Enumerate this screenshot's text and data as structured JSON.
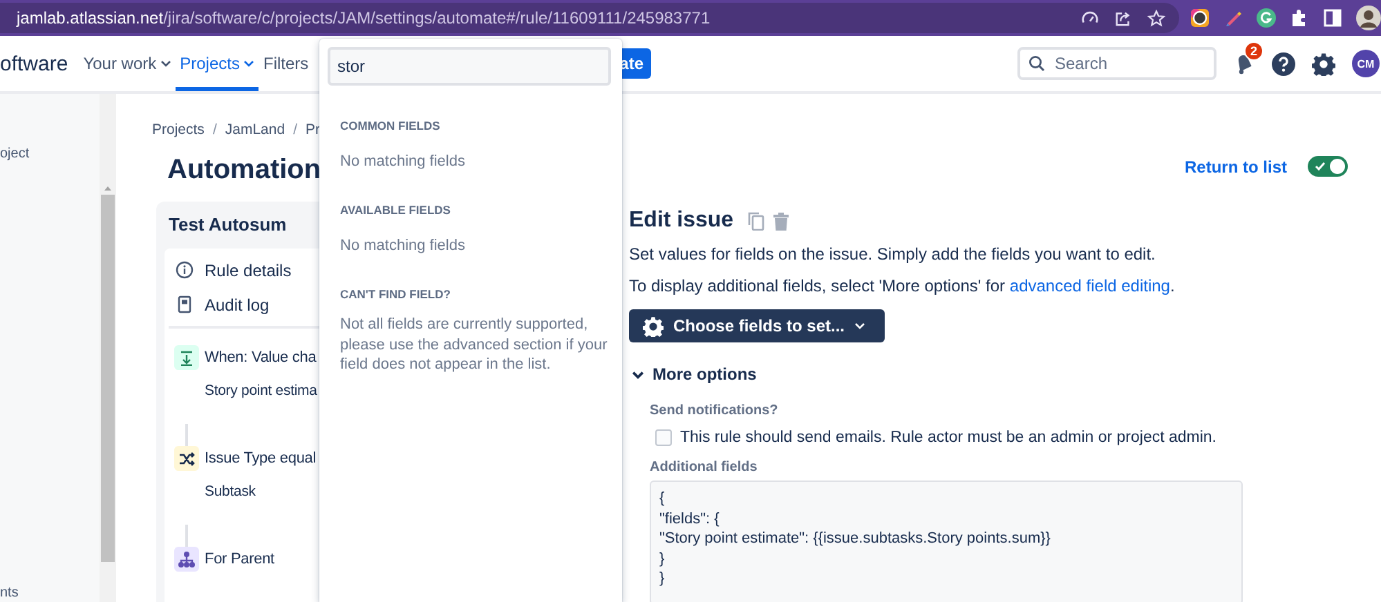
{
  "browser": {
    "url_host": "jamlab.atlassian.net",
    "url_path": "/jira/software/c/projects/JAM/settings/automate#/rule/11609111/245983771"
  },
  "top_nav": {
    "logo_text": "oftware",
    "items": [
      {
        "label": "Your work",
        "selected": false,
        "caret": true
      },
      {
        "label": "Projects",
        "selected": true,
        "caret": true
      },
      {
        "label": "Filters",
        "selected": false,
        "caret": false
      }
    ],
    "create_button": "ate",
    "search": {
      "placeholder": "Search"
    },
    "notification_count": "2",
    "avatar": "CM"
  },
  "sidebar": {
    "items": [
      "oject",
      "nts"
    ]
  },
  "breadcrumbs": [
    {
      "kind": "link",
      "text": "Projects"
    },
    {
      "kind": "separator",
      "text": "/"
    },
    {
      "kind": "link",
      "text": "JamLand"
    },
    {
      "kind": "separator",
      "text": "/"
    },
    {
      "kind": "link",
      "text": "Pr"
    }
  ],
  "page_title": "Automation",
  "return_link": "Return to list",
  "rule_enabled": true,
  "rule": {
    "title": "Test Autosum",
    "menu": [
      {
        "kind": "info",
        "label": "Rule details"
      },
      {
        "kind": "log",
        "label": "Audit log"
      }
    ],
    "steps": [
      {
        "kind": "trigger",
        "title": "When: Value cha",
        "detail": "Story point estima"
      },
      {
        "kind": "condition",
        "title": "Issue Type equal",
        "detail": "Subtask"
      },
      {
        "kind": "branch",
        "title": "For Parent"
      }
    ]
  },
  "field_picker": {
    "query": "stor",
    "sections": [
      {
        "heading": "COMMON FIELDS",
        "text": "No matching fields"
      },
      {
        "heading": "AVAILABLE FIELDS",
        "text": "No matching fields"
      },
      {
        "heading": "CAN'T FIND FIELD?",
        "text": "Not all fields are currently supported, please use the advanced section if your field does not appear in the list."
      }
    ]
  },
  "edit_panel": {
    "title": "Edit issue",
    "description": "Set values for fields on the issue. Simply add the fields you want to edit.",
    "hint": {
      "before": "To display additional fields, select 'More options' for ",
      "link": "advanced field editing",
      "after": "."
    },
    "choose_button": "Choose fields to set...",
    "more_options": {
      "label": "More options",
      "expanded": true
    },
    "notification": {
      "label": "Send notifications?",
      "text": "This rule should send emails. Rule actor must be an admin or project admin.",
      "checked": false
    },
    "additional_fields": {
      "label": "Additional fields",
      "lines": [
        "{",
        "\"fields\": {",
        "\"Story point estimate\": {{issue.subtasks.Story points.sum}}",
        "}",
        "}"
      ]
    }
  }
}
